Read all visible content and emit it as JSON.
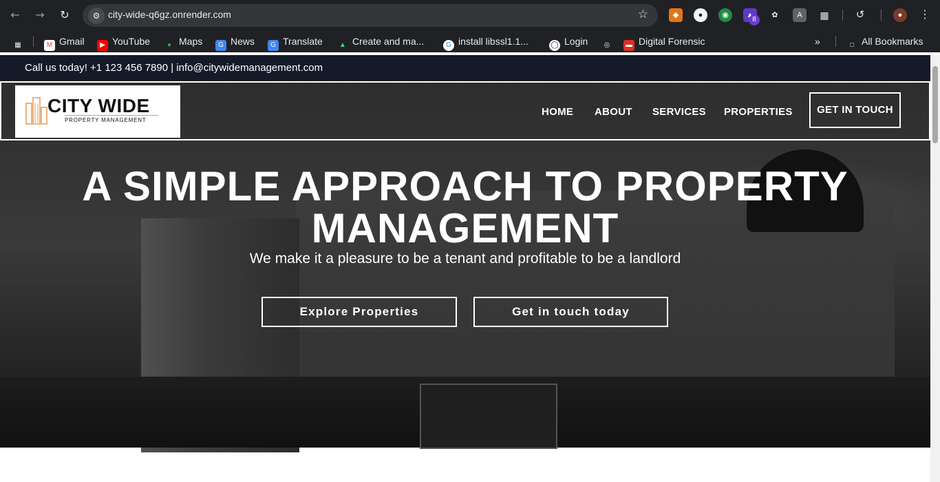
{
  "browser": {
    "url": "city-wide-q6gz.onrender.com",
    "extension_badge": "8",
    "bookmarks": [
      {
        "label": "Gmail"
      },
      {
        "label": "YouTube"
      },
      {
        "label": "Maps"
      },
      {
        "label": "News"
      },
      {
        "label": "Translate"
      },
      {
        "label": "Create and ma..."
      },
      {
        "label": "install libssl1.1..."
      },
      {
        "label": "Login"
      },
      {
        "label": ""
      },
      {
        "label": "Digital Forensic"
      }
    ],
    "all_bookmarks": "All Bookmarks"
  },
  "site": {
    "topbar_text": "Call us today! +1 123 456 7890 | info@citywidemanagement.com",
    "logo": {
      "title": "CITY WIDE",
      "subtitle": "PROPERTY MANAGEMENT"
    },
    "nav": [
      "HOME",
      "ABOUT",
      "SERVICES",
      "PROPERTIES"
    ],
    "nav_cta": "GET IN TOUCH",
    "hero": {
      "title_line1": "A SIMPLE APPROACH TO PROPERTY",
      "title_line2": "MANAGEMENT",
      "subtitle": "We make it a pleasure to be a tenant and profitable to be a landlord",
      "btn_explore": "Explore Properties",
      "btn_contact": "Get in touch today"
    }
  },
  "colors": {
    "chrome_bg": "#202124",
    "topbar_bg": "#141a28",
    "logo_accent": "#e39a57"
  }
}
